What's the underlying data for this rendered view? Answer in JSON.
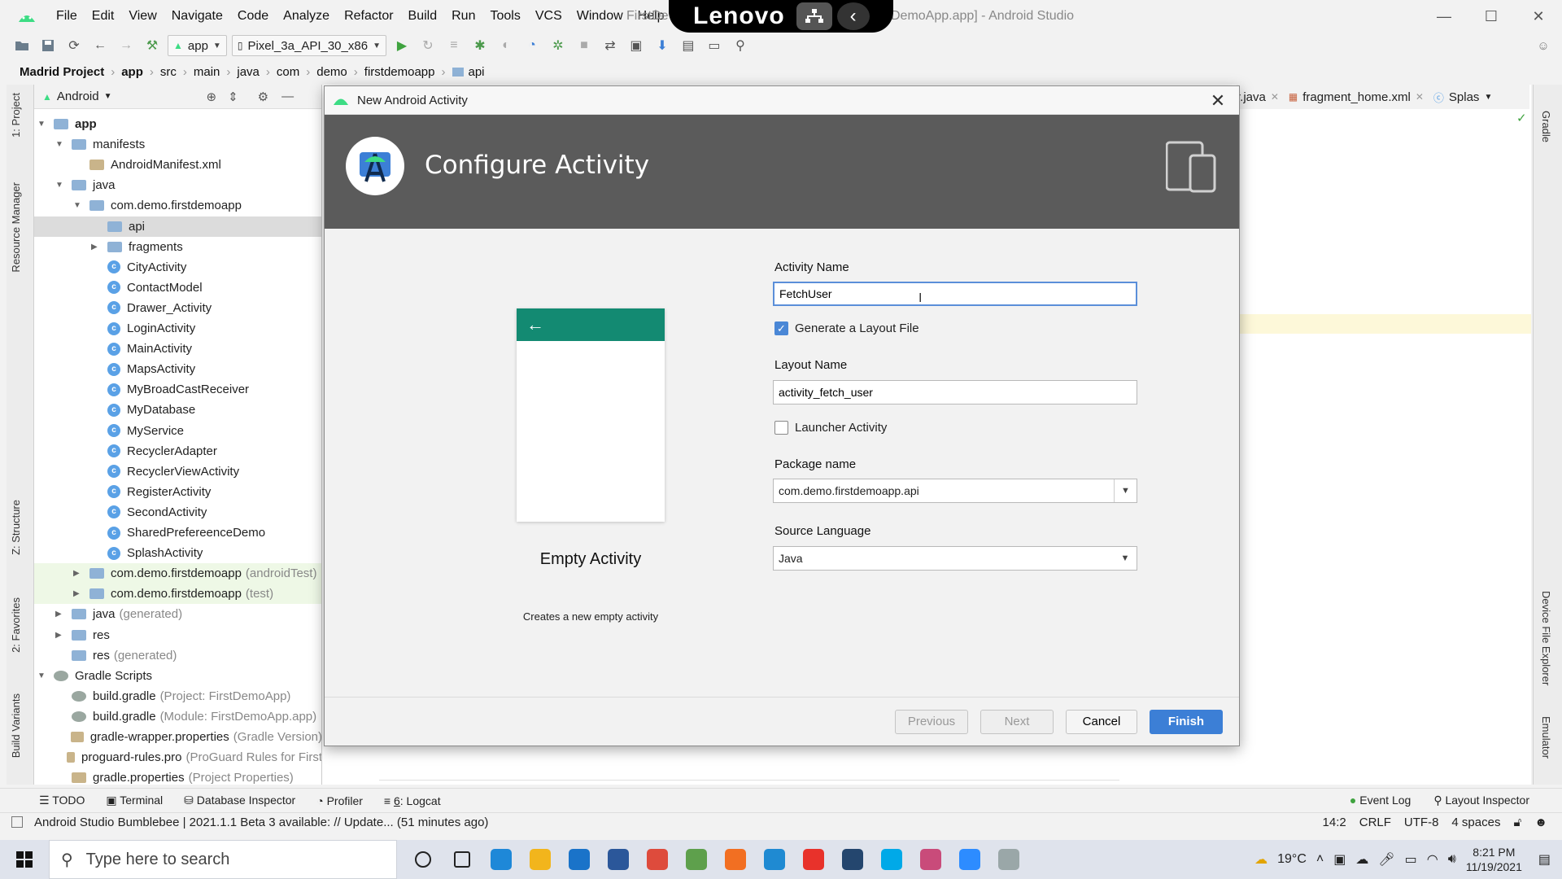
{
  "window": {
    "menu": [
      "File",
      "Edit",
      "View",
      "Navigate",
      "Code",
      "Analyze",
      "Refactor",
      "Build",
      "Run",
      "Tools",
      "VCS",
      "Window",
      "Help"
    ],
    "title_left": "FirstDe",
    "title_right": "DemoApp.app] - Android Studio",
    "overlay_brand": "Lenovo"
  },
  "toolbar": {
    "run_config": "app",
    "device": "Pixel_3a_API_30_x86"
  },
  "breadcrumb": [
    "Madrid Project",
    "app",
    "src",
    "main",
    "java",
    "com",
    "demo",
    "firstdemoapp",
    "api"
  ],
  "project_panel": {
    "view": "Android",
    "tree": [
      {
        "label": "app",
        "indent": 0,
        "type": "module",
        "toggle": "▼",
        "bold": true
      },
      {
        "label": "manifests",
        "indent": 1,
        "type": "folder",
        "toggle": "▼"
      },
      {
        "label": "AndroidManifest.xml",
        "indent": 2,
        "type": "file",
        "toggle": ""
      },
      {
        "label": "java",
        "indent": 1,
        "type": "folder",
        "toggle": "▼"
      },
      {
        "label": "com.demo.firstdemoapp",
        "indent": 2,
        "type": "folder",
        "toggle": "▼"
      },
      {
        "label": "api",
        "indent": 3,
        "type": "folder",
        "toggle": "",
        "selected": true
      },
      {
        "label": "fragments",
        "indent": 3,
        "type": "folder",
        "toggle": "▶"
      },
      {
        "label": "CityActivity",
        "indent": 3,
        "type": "class",
        "toggle": ""
      },
      {
        "label": "ContactModel",
        "indent": 3,
        "type": "class",
        "toggle": ""
      },
      {
        "label": "Drawer_Activity",
        "indent": 3,
        "type": "class",
        "toggle": ""
      },
      {
        "label": "LoginActivity",
        "indent": 3,
        "type": "class",
        "toggle": ""
      },
      {
        "label": "MainActivity",
        "indent": 3,
        "type": "class",
        "toggle": ""
      },
      {
        "label": "MapsActivity",
        "indent": 3,
        "type": "class",
        "toggle": ""
      },
      {
        "label": "MyBroadCastReceiver",
        "indent": 3,
        "type": "class",
        "toggle": ""
      },
      {
        "label": "MyDatabase",
        "indent": 3,
        "type": "class",
        "toggle": ""
      },
      {
        "label": "MyService",
        "indent": 3,
        "type": "class",
        "toggle": ""
      },
      {
        "label": "RecyclerAdapter",
        "indent": 3,
        "type": "class",
        "toggle": ""
      },
      {
        "label": "RecyclerViewActivity",
        "indent": 3,
        "type": "class",
        "toggle": ""
      },
      {
        "label": "RegisterActivity",
        "indent": 3,
        "type": "class",
        "toggle": ""
      },
      {
        "label": "SecondActivity",
        "indent": 3,
        "type": "class",
        "toggle": ""
      },
      {
        "label": "SharedPrefereenceDemo",
        "indent": 3,
        "type": "class",
        "toggle": ""
      },
      {
        "label": "SplashActivity",
        "indent": 3,
        "type": "class",
        "toggle": ""
      },
      {
        "label": "com.demo.firstdemoapp",
        "suffix": "(androidTest)",
        "indent": 2,
        "type": "folder",
        "toggle": "▶",
        "test": true
      },
      {
        "label": "com.demo.firstdemoapp",
        "suffix": "(test)",
        "indent": 2,
        "type": "folder",
        "toggle": "▶",
        "test": true
      },
      {
        "label": "java",
        "suffix": "(generated)",
        "indent": 1,
        "type": "folder",
        "toggle": "▶"
      },
      {
        "label": "res",
        "indent": 1,
        "type": "folder",
        "toggle": "▶"
      },
      {
        "label": "res",
        "suffix": "(generated)",
        "indent": 1,
        "type": "folder",
        "toggle": ""
      },
      {
        "label": "Gradle Scripts",
        "indent": 0,
        "type": "gradle",
        "toggle": "▼"
      },
      {
        "label": "build.gradle",
        "suffix": "(Project: FirstDemoApp)",
        "indent": 1,
        "type": "gradle",
        "toggle": ""
      },
      {
        "label": "build.gradle",
        "suffix": "(Module: FirstDemoApp.app)",
        "indent": 1,
        "type": "gradle",
        "toggle": ""
      },
      {
        "label": "gradle-wrapper.properties",
        "suffix": "(Gradle Version)",
        "indent": 1,
        "type": "file",
        "toggle": ""
      },
      {
        "label": "proguard-rules.pro",
        "suffix": "(ProGuard Rules for First",
        "indent": 1,
        "type": "file",
        "toggle": ""
      },
      {
        "label": "gradle.properties",
        "suffix": "(Project Properties)",
        "indent": 1,
        "type": "file",
        "toggle": ""
      }
    ]
  },
  "left_strip": {
    "project": "1: Project",
    "resource": "Resource Manager",
    "structure": "Z: Structure",
    "favorites": "2: Favorites",
    "variants": "Build Variants"
  },
  "right_strip": {
    "gradle": "Gradle",
    "device_explorer": "Device File Explorer",
    "emulator": "Emulator"
  },
  "editor_tabs": [
    {
      "label": "r.java"
    },
    {
      "label": "fragment_home.xml"
    },
    {
      "label": "Splas"
    }
  ],
  "dialog": {
    "title": "New Android Activity",
    "header": "Configure Activity",
    "template_name": "Empty Activity",
    "template_desc": "Creates a new empty activity",
    "activity_name_label": "Activity Name",
    "activity_name": "FetchUser",
    "generate_layout_label": "Generate a Layout File",
    "generate_layout_checked": true,
    "layout_name_label": "Layout Name",
    "layout_name": "activity_fetch_user",
    "launcher_label": "Launcher Activity",
    "launcher_checked": false,
    "package_label": "Package name",
    "package": "com.demo.firstdemoapp.api",
    "language_label": "Source Language",
    "language": "Java",
    "buttons": {
      "previous": "Previous",
      "next": "Next",
      "cancel": "Cancel",
      "finish": "Finish"
    }
  },
  "tool_tabs": {
    "todo": "TODO",
    "terminal": "Terminal",
    "db": "Database Inspector",
    "profiler": "Profiler",
    "logcat_num": "6",
    "logcat": ": Logcat",
    "event_log": "Event Log",
    "layout_inspector": "Layout Inspector"
  },
  "status": {
    "message": "Android Studio Bumblebee | 2021.1.1 Beta 3 available: // Update... (51 minutes ago)",
    "position": "14:2",
    "line_sep": "CRLF",
    "encoding": "UTF-8",
    "indent": "4 spaces"
  },
  "taskbar": {
    "search_placeholder": "Type here to search",
    "weather": "19°C",
    "time": "8:21 PM",
    "date": "11/19/2021",
    "apps": [
      {
        "name": "cortana-icon",
        "color": "#ffffff"
      },
      {
        "name": "task-view-icon",
        "color": "#ffffff"
      },
      {
        "name": "edge-icon",
        "color": "#1e88d8"
      },
      {
        "name": "file-explorer-icon",
        "color": "#f2b51c"
      },
      {
        "name": "mail-icon",
        "color": "#1a73c9"
      },
      {
        "name": "word-icon",
        "color": "#2b579a"
      },
      {
        "name": "chrome-icon",
        "color": "#de4b3c"
      },
      {
        "name": "app-green-icon",
        "color": "#5ea04c"
      },
      {
        "name": "app-orange-icon",
        "color": "#f26f22"
      },
      {
        "name": "vscode-icon",
        "color": "#1f8ad2"
      },
      {
        "name": "anydesk-icon",
        "color": "#e8322b"
      },
      {
        "name": "app-dark-icon",
        "color": "#24466e"
      },
      {
        "name": "skype-icon",
        "color": "#00a9e8"
      },
      {
        "name": "app-paint-icon",
        "color": "#c94b7a"
      },
      {
        "name": "zoom-icon",
        "color": "#2d8cff"
      },
      {
        "name": "app-tool-icon",
        "color": "#9aa7a8"
      }
    ]
  },
  "colors": {
    "accent": "#3c7fd6",
    "dialog_header": "#5b5b5b",
    "preview_bar": "#138a72"
  }
}
